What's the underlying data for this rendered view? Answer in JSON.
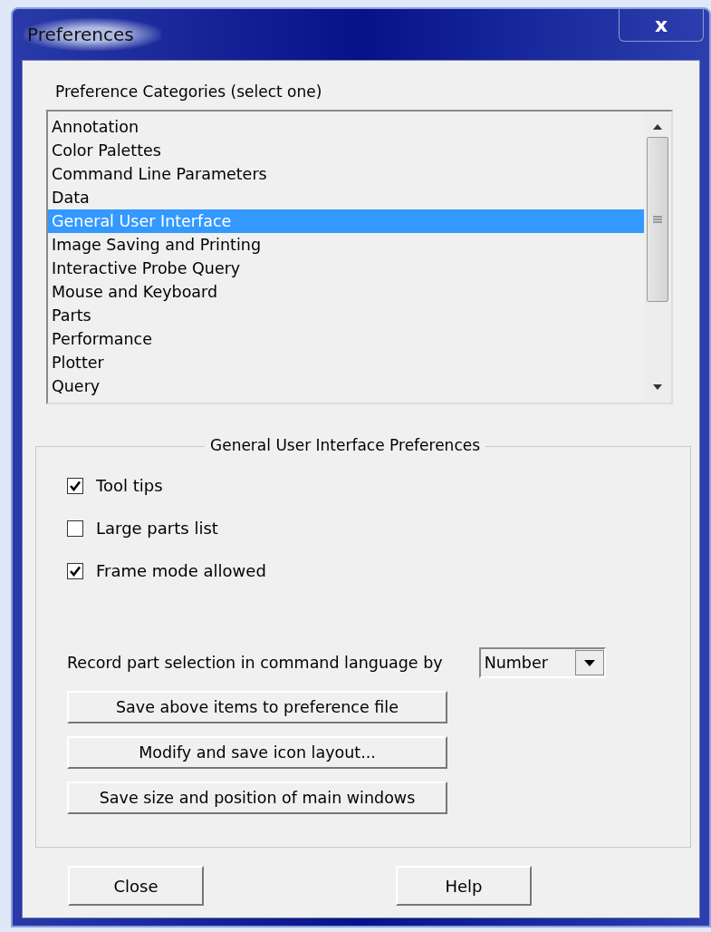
{
  "window": {
    "title": "Preferences",
    "close_glyph": "x"
  },
  "categories": {
    "label": "Preference Categories (select one)",
    "items": [
      {
        "label": "Annotation",
        "selected": false
      },
      {
        "label": "Color Palettes",
        "selected": false
      },
      {
        "label": "Command Line Parameters",
        "selected": false
      },
      {
        "label": "Data",
        "selected": false
      },
      {
        "label": "General User Interface",
        "selected": true
      },
      {
        "label": "Image Saving and Printing",
        "selected": false
      },
      {
        "label": "Interactive Probe Query",
        "selected": false
      },
      {
        "label": "Mouse and Keyboard",
        "selected": false
      },
      {
        "label": "Parts",
        "selected": false
      },
      {
        "label": "Performance",
        "selected": false
      },
      {
        "label": "Plotter",
        "selected": false
      },
      {
        "label": "Query",
        "selected": false
      }
    ]
  },
  "group": {
    "title": "General User Interface Preferences",
    "options": [
      {
        "label": "Tool tips",
        "checked": true
      },
      {
        "label": "Large parts list",
        "checked": false
      },
      {
        "label": "Frame mode allowed",
        "checked": true
      }
    ],
    "record": {
      "label": "Record part selection in command language by",
      "value": "Number"
    },
    "actions": [
      "Save above items to preference file",
      "Modify and save icon layout...",
      "Save size and position of main windows"
    ]
  },
  "buttons": [
    "Close",
    "Help"
  ]
}
